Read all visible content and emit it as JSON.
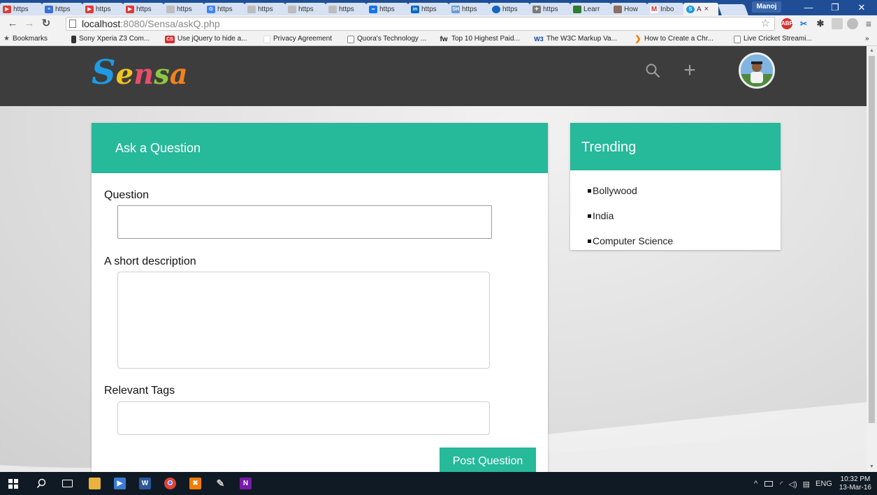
{
  "browser": {
    "tabs": [
      {
        "label": "https",
        "color": "#e53935"
      },
      {
        "label": "https",
        "color": "#3b6fd6"
      },
      {
        "label": "https",
        "color": "#e53935"
      },
      {
        "label": "https",
        "color": "#e53935"
      },
      {
        "label": "https",
        "color": "#9e9e9e"
      },
      {
        "label": "https",
        "color": "#4285f4"
      },
      {
        "label": "https",
        "color": "#9e9e9e"
      },
      {
        "label": "https",
        "color": "#9e9e9e"
      },
      {
        "label": "https",
        "color": "#9e9e9e"
      },
      {
        "label": "https",
        "color": "#1a73e8"
      },
      {
        "label": "https",
        "color": "#0a66c2"
      },
      {
        "label": "https",
        "color": "#6b9bd2"
      },
      {
        "label": "https",
        "color": "#1565c0"
      },
      {
        "label": "https",
        "color": "#7a7a7a"
      },
      {
        "label": "Learr",
        "color": "#2e7d32"
      },
      {
        "label": "How",
        "color": "#8d6e63"
      },
      {
        "label": "Inbo",
        "color": "#d93025"
      },
      {
        "label": "A",
        "color": "#1e9be3"
      }
    ],
    "profile_name": "Manoj",
    "url_host": "localhost",
    "url_rest": ":8080/Sensa/askQ.php",
    "bookmarks_label": "Bookmarks",
    "bookmarks": [
      {
        "label": "Sony Xperia Z3 Com...",
        "color": "#333333"
      },
      {
        "label": "Use jQuery to hide a...",
        "color": "#d32f2f",
        "glyph": "CS"
      },
      {
        "label": "Privacy Agreement",
        "color": "#ffffff"
      },
      {
        "label": "Quora's Technology ...",
        "color": "#9e9e9e"
      },
      {
        "label": "Top 10 Highest Paid...",
        "color": "#2d2d2d",
        "glyph": "fw"
      },
      {
        "label": "The W3C Markup Va...",
        "color": "#0d47a1",
        "glyph": "W3"
      },
      {
        "label": "How to Create a Chr...",
        "color": "#f57c00"
      },
      {
        "label": "Live Cricket Streami...",
        "color": "#9e9e9e"
      }
    ],
    "bookmarks_overflow": "»"
  },
  "header": {
    "logo_letters": [
      "S",
      "e",
      "n",
      "s",
      "a"
    ]
  },
  "ask": {
    "title": "Ask a Question",
    "question_label": "Question",
    "question_value": "",
    "description_label": "A short description",
    "description_value": "",
    "tags_label": "Relevant Tags",
    "tags_value": "",
    "submit_label": "Post Question"
  },
  "trending": {
    "title": "Trending",
    "items": [
      "Bollywood",
      "India",
      "Computer Science"
    ]
  },
  "taskbar": {
    "language": "ENG",
    "time": "10:32 PM",
    "date": "13-Mar-16"
  },
  "colors": {
    "accent": "#26b99a",
    "header_bg": "#3d3d3d",
    "tabstrip_bg": "#1f4e96"
  }
}
